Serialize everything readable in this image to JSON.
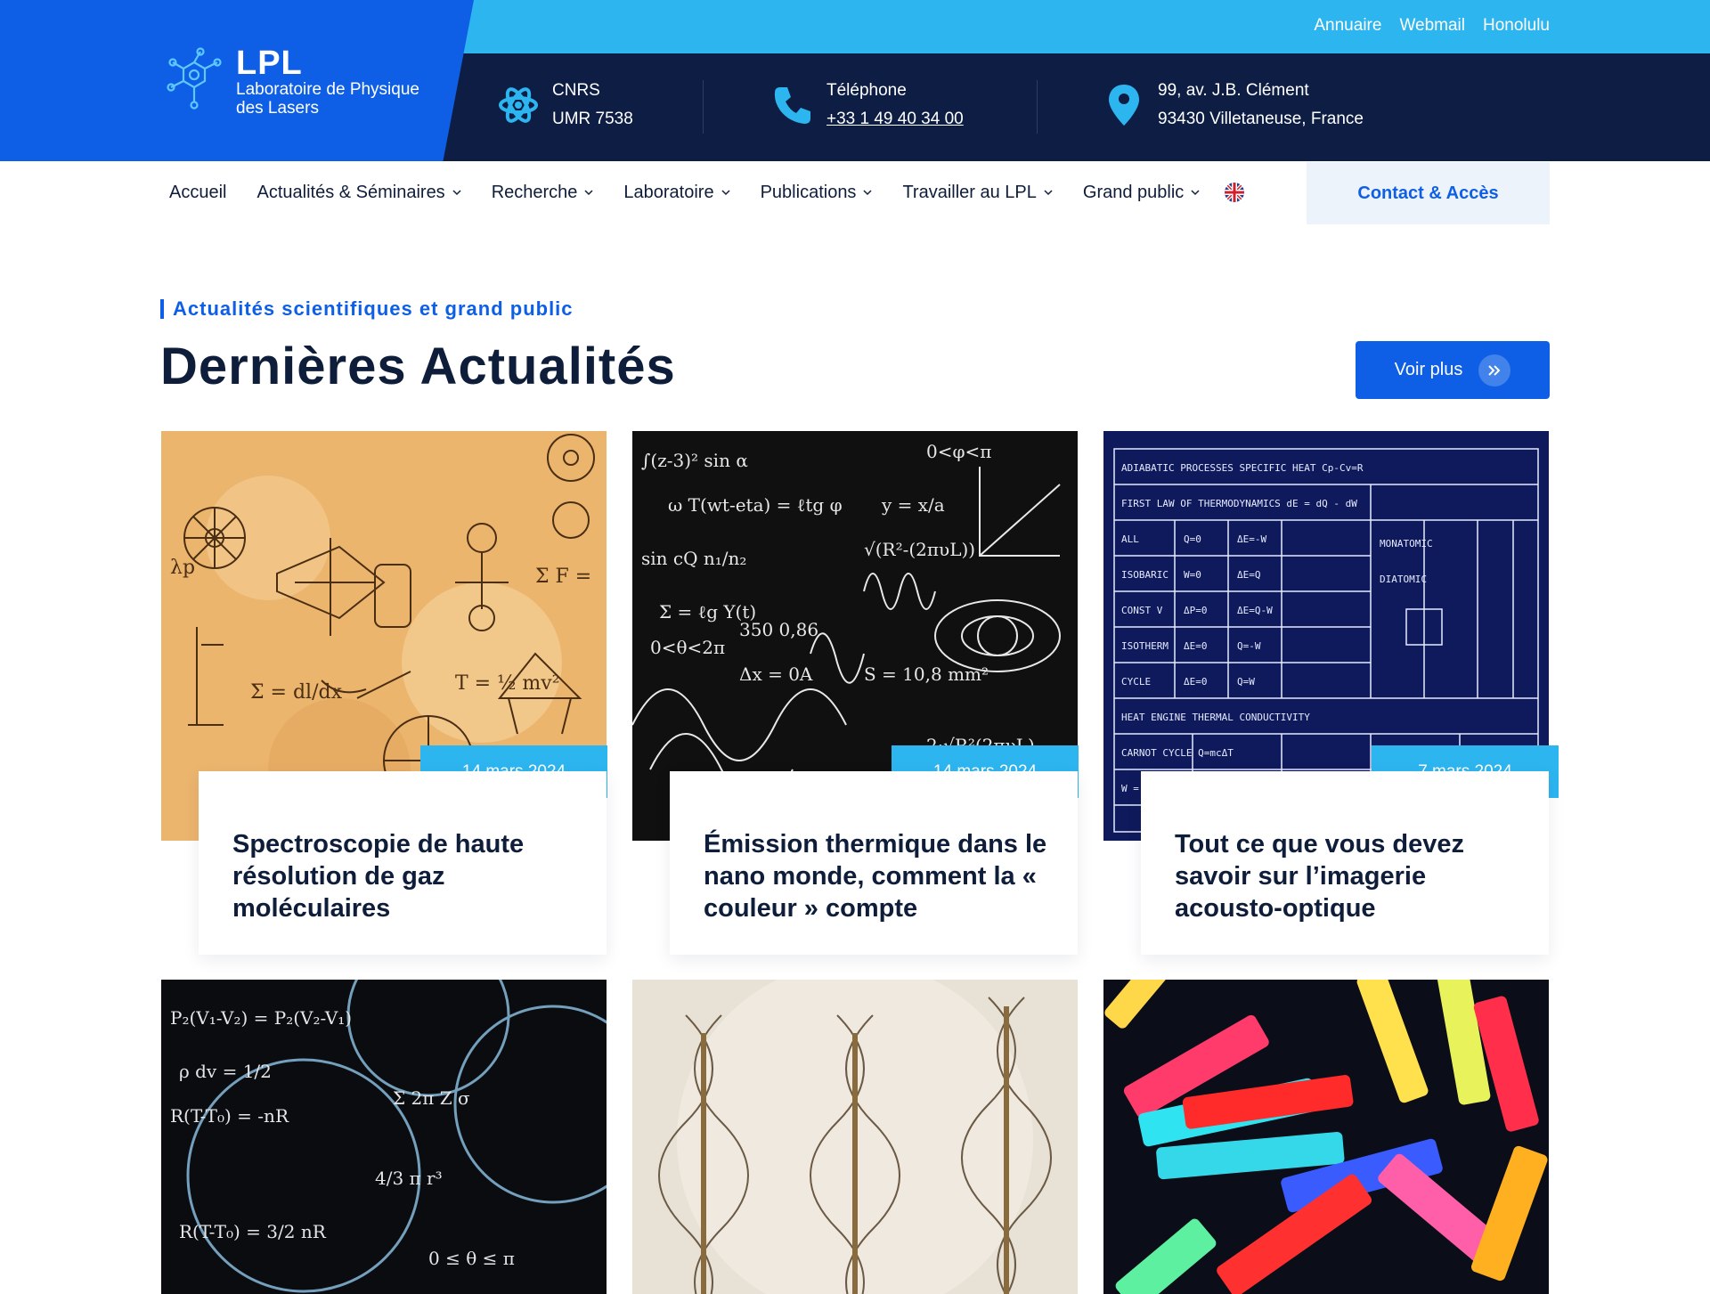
{
  "header": {
    "logo": {
      "title": "LPL",
      "subtitle": "Laboratoire de Physique des Lasers"
    },
    "top_links": [
      "Annuaire",
      "Webmail",
      "Honolulu"
    ],
    "info": [
      {
        "icon": "atom-icon",
        "line1": "CNRS",
        "line2": "UMR 7538"
      },
      {
        "icon": "phone-icon",
        "line1": "Téléphone",
        "line2": "+33 1 49 40 34 00"
      },
      {
        "icon": "location-pin-icon",
        "line1": "99, av. J.B. Clément",
        "line2": "93430 Villetaneuse, France"
      }
    ]
  },
  "nav": {
    "items": [
      {
        "label": "Accueil",
        "dropdown": false
      },
      {
        "label": "Actualités & Séminaires",
        "dropdown": true
      },
      {
        "label": "Recherche",
        "dropdown": true
      },
      {
        "label": "Laboratoire",
        "dropdown": true
      },
      {
        "label": "Publications",
        "dropdown": true
      },
      {
        "label": "Travailler au LPL",
        "dropdown": true
      },
      {
        "label": "Grand public",
        "dropdown": true
      }
    ],
    "language_icon": "uk-flag-icon",
    "contact_label": "Contact & Accès"
  },
  "section": {
    "eyebrow": "Actualités scientifiques et grand public",
    "title": "Dernières Actualités",
    "more_label": "Voir plus"
  },
  "cards": [
    {
      "date": "14 mars 2024",
      "title": "Spectroscopie de haute résolution de gaz moléculaires"
    },
    {
      "date": "14 mars 2024",
      "title": "Émission thermique dans le nano monde, comment la « couleur » compte"
    },
    {
      "date": "7 mars 2024",
      "title": "Tout ce que vous devez savoir sur l’imagerie acousto-optique"
    }
  ],
  "colors": {
    "brand_blue": "#0e5fe6",
    "sky_blue": "#2db5f0",
    "navy": "#0e1d44"
  }
}
